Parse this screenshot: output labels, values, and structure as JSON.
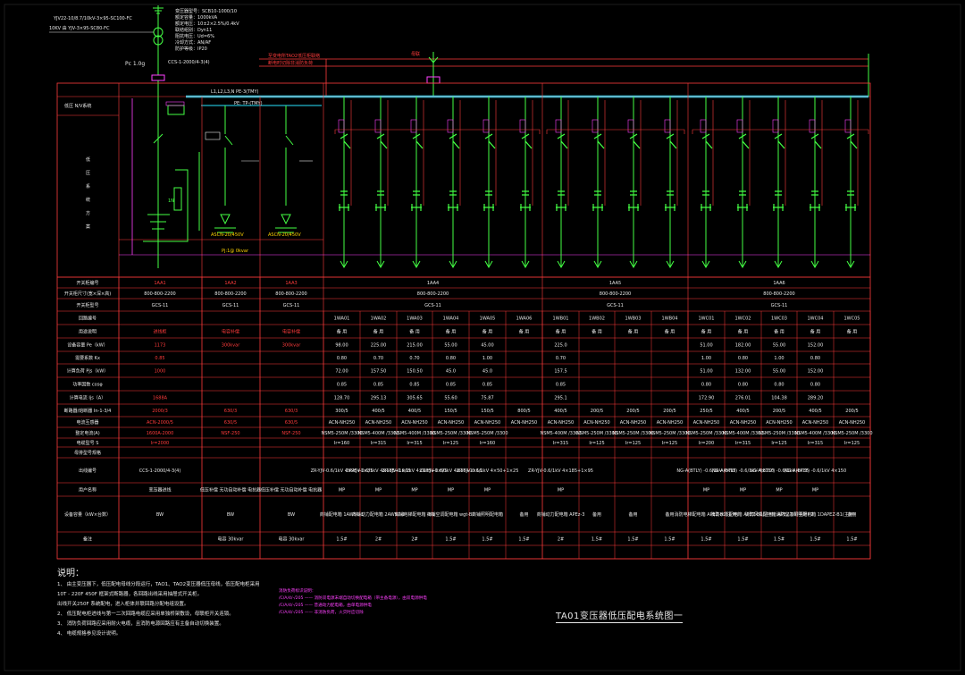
{
  "header": {
    "incoming": [
      "YJV22-10/8.7/10kV-3×95-SC100-FC",
      "10KV 由 YJV-3×95-SC80-FC"
    ],
    "transformer_specs": [
      "变压器型号：SCB10-1000/10",
      "额定容量：1000kVA",
      "额定电压：10±2×2.5%/0.4kV",
      "联结组别：Dyn11",
      "阻抗电压：Ud=6%",
      "冷却方式：AN/AF",
      "防护等级：IP20",
      "CCS-1-2000/4-3(4)"
    ],
    "pc_label": "Pc 1.0g",
    "red_notes": [
      "至变电所TAO2低压柜联络",
      "断电时切除非消防负荷"
    ],
    "red_mark": "母联",
    "bus_label": "L1,L2,L3,N PE-3(TMY)",
    "pen_label": "PE: TP-(TMY)",
    "side_label": "低压 N/V系统",
    "pf_label": "Pj:1@ 0kvar"
  },
  "table_labels": [
    "开关柜编号",
    "开关柜尺寸(宽×深×高)",
    "开关柜型号",
    "回路编号",
    "用途说明",
    "设备容量 Pe（kW）",
    "需要系数 Kx",
    "计算负荷 Pjs（kW）",
    "功率因数 cosφ",
    "计算电流 Ijs（A）",
    "断路器/熔断器 In-1-3/4",
    "电流互感器",
    "整定电流(A)",
    "电缆型号 S",
    "母排型号规格",
    "出线编号",
    "用户名称",
    "设备容量（kW×台数）",
    "备注"
  ],
  "left_columns": [
    {
      "id": "1AA1",
      "size": "800-800-2200",
      "model": "GCS-11",
      "use": "进线柜",
      "pe": "1173",
      "kx": "0.85",
      "pjs": "1000",
      "ijs": "1688A",
      "brk": "2000/3",
      "ct": "ACN-2000/5",
      "set": "1600A-2000",
      "cable": "Ir=2000",
      "busbar": "CCS-1-2000/4-3(4)",
      "user": "变压器进线",
      "cap": "BW",
      "note": ""
    },
    {
      "id": "1AA2",
      "size": "800-800-2200",
      "model": "GCS-11",
      "use": "电容补偿",
      "pe": "300kvar",
      "kx": "",
      "pjs": "",
      "ijs": "",
      "brk": "630/3",
      "ct": "630/5",
      "set": "NSF-250",
      "cable": "",
      "busbar": "",
      "user": "低压补偿 无功自动补偿 电抗器",
      "cap": "BW",
      "note": "电容 30kvar"
    },
    {
      "id": "1AA3",
      "size": "800-800-2200",
      "model": "GCS-11",
      "use": "电容补偿",
      "pe": "300kvar",
      "kx": "",
      "pjs": "",
      "ijs": "",
      "brk": "630/3",
      "ct": "630/5",
      "set": "NSF-250",
      "cable": "",
      "busbar": "",
      "user": "低压补偿 无功自动补偿 电抗器",
      "cap": "BW",
      "note": "电容 30kvar"
    }
  ],
  "panels": [
    {
      "id": "1AA4",
      "size": "800-800-2200",
      "model": "GCS-11"
    },
    {
      "id": "1AA5",
      "size": "800-800-2200",
      "model": "GCS-11"
    },
    {
      "id": "1AA6",
      "size": "800-800-2200",
      "model": "GCS-11"
    }
  ],
  "circuits": [
    {
      "id": "1WA01",
      "use": "备 用",
      "pe": "98.00",
      "kx": "0.80",
      "pjs": "72.00",
      "cos": "0.85",
      "ijs": "128.70",
      "brk": "300/5",
      "ct": "ACN-NH250",
      "set": "NSM5-250M /3300",
      "ir": "Ir=160",
      "cable": "ZR-YJV-0.6/1kV 4×95+1×35",
      "pf": "MP",
      "user": "商铺配电箱 1AW5C-1",
      "cap": "1.5#"
    },
    {
      "id": "1WA02",
      "use": "备 用",
      "pe": "225.00",
      "kx": "0.70",
      "pjs": "157.50",
      "cos": "0.85",
      "ijs": "295.13",
      "brk": "400/5",
      "ct": "ACN-NH250",
      "set": "NSM5-400M /3300",
      "ir": "Ir=315",
      "cable": "ZR-YJV-0.6/1kV 4×185+1×95",
      "pf": "MP",
      "user": "商铺动力配电箱 2AW5Z-1",
      "cap": "2#"
    },
    {
      "id": "1WA03",
      "use": "备 用",
      "pe": "215.00",
      "kx": "0.70",
      "pjs": "150.50",
      "cos": "0.85",
      "ijs": "305.65",
      "brk": "400/5",
      "ct": "ACN-NH250",
      "set": "NSM5-400M /3300",
      "ir": "Ir=315",
      "cable": "ZR-YJV-0.6/1kV 4×185+1×95",
      "pf": "MP",
      "user": "商铺电梯配电箱 -B1",
      "cap": "2#"
    },
    {
      "id": "1WA04",
      "use": "备 用",
      "pe": "55.00",
      "kx": "0.80",
      "pjs": "45.0",
      "cos": "0.85",
      "ijs": "55.60",
      "brk": "150/5",
      "ct": "ACN-NH250",
      "set": "NSM5-250M /3300",
      "ir": "Ir=125",
      "cable": "ZR-YJV-0.6/1kV 4×35+1×16",
      "pf": "MP",
      "user": "商铺空调配电箱 wgt-B1",
      "cap": "1.5#"
    },
    {
      "id": "1WA05",
      "use": "备 用",
      "pe": "45.00",
      "kx": "1.00",
      "pjs": "45.0",
      "cos": "0.85",
      "ijs": "75.87",
      "brk": "150/5",
      "ct": "ACN-NH250",
      "set": "NSM5-250M /3300",
      "ir": "Ir=160",
      "cable": "ZR-YJV-0.6/1kV 4×50+1×25",
      "pf": "MP",
      "user": "商铺照明配电箱",
      "cap": "1.5#"
    },
    {
      "id": "1WA06",
      "use": "备 用",
      "pe": "",
      "kx": "",
      "pjs": "",
      "cos": "",
      "ijs": "",
      "brk": "800/5",
      "ct": "ACN-NH250",
      "set": "",
      "ir": "",
      "cable": "",
      "pf": "",
      "user": "备用",
      "cap": "1.5#"
    },
    {
      "id": "1WB01",
      "use": "备 用",
      "pe": "225.0",
      "kx": "0.70",
      "pjs": "157.5",
      "cos": "0.85",
      "ijs": "295.1",
      "brk": "400/5",
      "ct": "ACN-NH250",
      "set": "NSM5-400M /3300",
      "ir": "Ir=315",
      "cable": "ZR-YJV-0.6/1kV 4×185+1×95",
      "pf": "MP",
      "user": "商铺动力配电箱 APEz-3",
      "cap": "2#"
    },
    {
      "id": "1WB02",
      "use": "备 用",
      "pe": "",
      "kx": "",
      "pjs": "",
      "cos": "",
      "ijs": "",
      "brk": "200/5",
      "ct": "ACN-NH250",
      "set": "NSM5-250M /3300",
      "ir": "Ir=125",
      "cable": "",
      "pf": "",
      "user": "备用",
      "cap": "1.5#"
    },
    {
      "id": "1WB03",
      "use": "备 用",
      "pe": "",
      "kx": "",
      "pjs": "",
      "cos": "",
      "ijs": "",
      "brk": "200/5",
      "ct": "ACN-NH250",
      "set": "NSM5-250M /3300",
      "ir": "Ir=125",
      "cable": "",
      "pf": "",
      "user": "备用",
      "cap": "1.5#"
    },
    {
      "id": "1WB04",
      "use": "备 用",
      "pe": "",
      "kx": "",
      "pjs": "",
      "cos": "",
      "ijs": "",
      "brk": "200/5",
      "ct": "ACN-NH250",
      "set": "NSM5-250M /3300",
      "ir": "Ir=125",
      "cable": "",
      "pf": "",
      "user": "备用",
      "cap": "1.5#"
    },
    {
      "id": "1WC01",
      "use": "备 用",
      "pe": "51.00",
      "kx": "1.00",
      "pjs": "51.00",
      "cos": "0.80",
      "ijs": "172.90",
      "brk": "250/5",
      "ct": "ACN-NH250",
      "set": "NSM5-250M /3300",
      "ir": "Ir=200",
      "cable": "NG-A(BTLY) -0.6/1kV 4×95",
      "pf": "MP",
      "user": "消防电梯配电箱 APEZ-B1(主用)",
      "cap": "1.5#"
    },
    {
      "id": "1WC02",
      "use": "备 用",
      "pe": "182.00",
      "kx": "0.80",
      "pjs": "132.00",
      "cos": "0.80",
      "ijs": "276.01",
      "brk": "400/5",
      "ct": "ACN-NH250",
      "set": "NSM5-400M /3300",
      "ir": "Ir=315",
      "cable": "NG-A(BTLY) -0.6/1kV 4×150",
      "pf": "MP",
      "user": "消防水泵配电箱 APEZ-B1(主用)",
      "cap": "1.5#"
    },
    {
      "id": "1WC03",
      "use": "备 用",
      "pe": "55.00",
      "kx": "1.00",
      "pjs": "55.00",
      "cos": "0.80",
      "ijs": "104.38",
      "brk": "200/5",
      "ct": "ACN-NH250",
      "set": "NSM5-250M /3300",
      "ir": "Ir=125",
      "cable": "NG-A(BTLY) -0.6/1kV 4×35",
      "pf": "MP",
      "user": "消防风机配电箱 APEZ-B1(主用) 2",
      "cap": "1.5#"
    },
    {
      "id": "1WC04",
      "use": "备 用",
      "pe": "152.00",
      "kx": "0.80",
      "pjs": "152.00",
      "cos": "0.80",
      "ijs": "289.20",
      "brk": "400/5",
      "ct": "ACN-NH250",
      "set": "NSM5-400M /3300",
      "ir": "Ir=315",
      "cable": "NG-A(BTLY) -0.6/1kV 4×150",
      "pf": "MP",
      "user": "消防应急照明配电箱 1DAPEZ-B1(主用)",
      "cap": "1.5#"
    },
    {
      "id": "1WC05",
      "use": "备 用",
      "pe": "",
      "kx": "",
      "pjs": "",
      "cos": "",
      "ijs": "",
      "brk": "200/5",
      "ct": "ACN-NH250",
      "set": "NSM5-250M /3300",
      "ir": "Ir=125",
      "cable": "",
      "pf": "",
      "user": "备用",
      "cap": "1.5#"
    }
  ],
  "notes": {
    "heading": "说明：",
    "lines": [
      "1、 由主变压器下，低压配电母线分段运行，TAO1、TAO2变压器低压母线，低压配电柜采用",
      "10T - 220F 450F 框架式断路器，各回路出线采用抽屉式开关柜。",
      "出线开关250F 系统配电，进入柜体并联回路分配电组设置。",
      "2、 低压配电柜进线与第一二次回路电缆应采用单独桥架敷设，母联柜开关连锁。",
      "3、 消防负荷回路应采用耐火电缆，且消防电源回路应有主备自动切换装置。",
      "4、 电缆规格参见设计说明。"
    ]
  },
  "legend": {
    "heading": "消防负荷标识说明：",
    "lines": [
      "/C/A/4/-/205  ——  消防双电源末端自动切换配电箱（带主备电源），由双电源供电",
      "/C/A/4/-/205  ——  普通动力配电箱，由单电源供电",
      "/C/A/4/-/205  ——  非消防负荷，火灾时应切除"
    ]
  },
  "title": "TA01变压器低压配电系统图一"
}
